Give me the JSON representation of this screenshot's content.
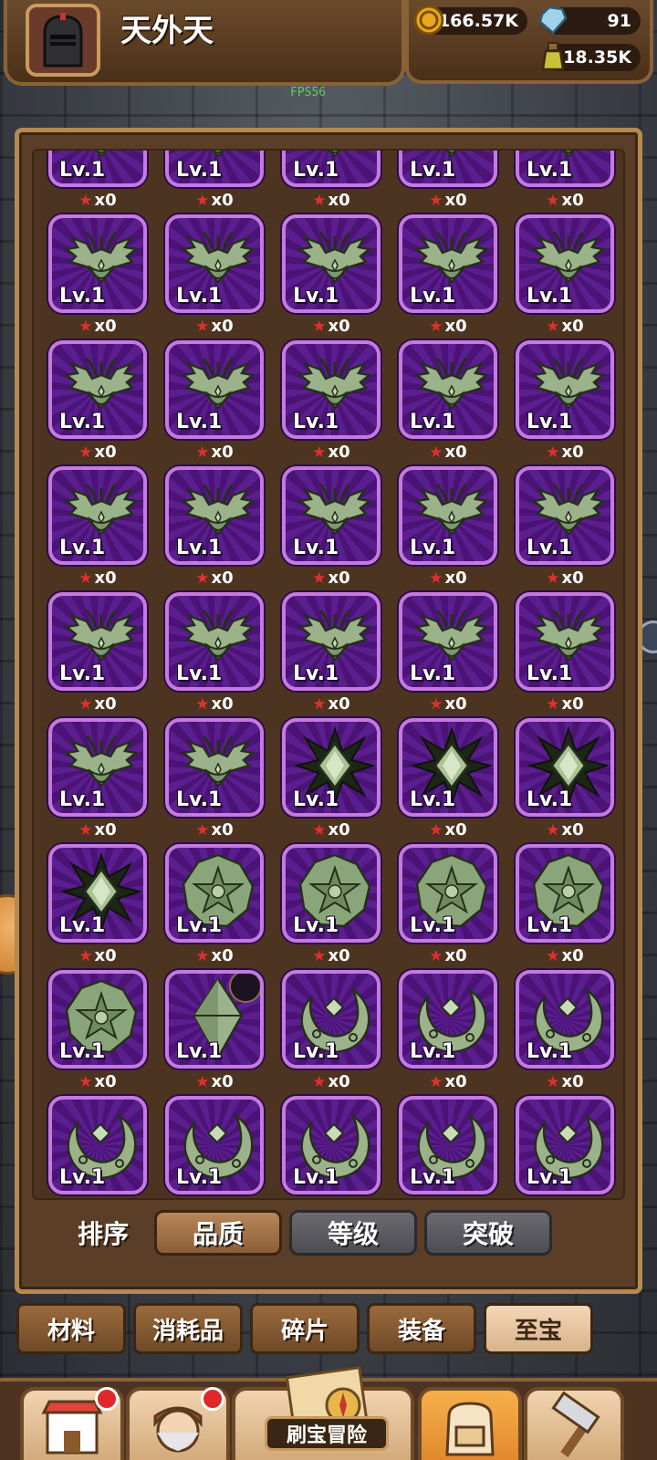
{
  "header": {
    "player_name": "天外天",
    "avatar_icon": "knight-helmet-icon",
    "gold": "166.57K",
    "gems": "91",
    "potion": "18.35K",
    "fps": "FPS56"
  },
  "items": [
    {
      "icon": "wing-emblem",
      "level": "Lv.1",
      "count": "x0"
    },
    {
      "icon": "wing-emblem",
      "level": "Lv.1",
      "count": "x0"
    },
    {
      "icon": "wing-emblem",
      "level": "Lv.1",
      "count": "x0"
    },
    {
      "icon": "wing-emblem",
      "level": "Lv.1",
      "count": "x0"
    },
    {
      "icon": "wing-emblem",
      "level": "Lv.1",
      "count": "x0"
    },
    {
      "icon": "wing-emblem",
      "level": "Lv.1",
      "count": "x0"
    },
    {
      "icon": "wing-emblem",
      "level": "Lv.1",
      "count": "x0"
    },
    {
      "icon": "wing-emblem",
      "level": "Lv.1",
      "count": "x0"
    },
    {
      "icon": "wing-emblem",
      "level": "Lv.1",
      "count": "x0"
    },
    {
      "icon": "wing-emblem",
      "level": "Lv.1",
      "count": "x0"
    },
    {
      "icon": "wing-emblem",
      "level": "Lv.1",
      "count": "x0"
    },
    {
      "icon": "wing-emblem",
      "level": "Lv.1",
      "count": "x0"
    },
    {
      "icon": "wing-emblem",
      "level": "Lv.1",
      "count": "x0"
    },
    {
      "icon": "wing-emblem",
      "level": "Lv.1",
      "count": "x0"
    },
    {
      "icon": "wing-emblem",
      "level": "Lv.1",
      "count": "x0"
    },
    {
      "icon": "wing-emblem",
      "level": "Lv.1",
      "count": "x0"
    },
    {
      "icon": "wing-emblem",
      "level": "Lv.1",
      "count": "x0"
    },
    {
      "icon": "wing-emblem",
      "level": "Lv.1",
      "count": "x0"
    },
    {
      "icon": "wing-emblem",
      "level": "Lv.1",
      "count": "x0"
    },
    {
      "icon": "wing-emblem",
      "level": "Lv.1",
      "count": "x0"
    },
    {
      "icon": "wing-emblem",
      "level": "Lv.1",
      "count": "x0"
    },
    {
      "icon": "wing-emblem",
      "level": "Lv.1",
      "count": "x0"
    },
    {
      "icon": "wing-emblem",
      "level": "Lv.1",
      "count": "x0"
    },
    {
      "icon": "wing-emblem",
      "level": "Lv.1",
      "count": "x0"
    },
    {
      "icon": "wing-emblem",
      "level": "Lv.1",
      "count": "x0"
    },
    {
      "icon": "wing-emblem",
      "level": "Lv.1",
      "count": "x0"
    },
    {
      "icon": "wing-emblem",
      "level": "Lv.1",
      "count": "x0"
    },
    {
      "icon": "spiked-star",
      "level": "Lv.1",
      "count": "x0"
    },
    {
      "icon": "spiked-star",
      "level": "Lv.1",
      "count": "x0"
    },
    {
      "icon": "spiked-star",
      "level": "Lv.1",
      "count": "x0"
    },
    {
      "icon": "spiked-star",
      "level": "Lv.1",
      "count": "x0"
    },
    {
      "icon": "star-medallion",
      "level": "Lv.1",
      "count": "x0"
    },
    {
      "icon": "star-medallion",
      "level": "Lv.1",
      "count": "x0"
    },
    {
      "icon": "star-medallion",
      "level": "Lv.1",
      "count": "x0"
    },
    {
      "icon": "star-medallion",
      "level": "Lv.1",
      "count": "x0"
    },
    {
      "icon": "star-medallion",
      "level": "Lv.1",
      "count": "x0"
    },
    {
      "icon": "crystal-diamond",
      "level": "Lv.1",
      "count": "x0",
      "badge": true
    },
    {
      "icon": "crescent-moon",
      "level": "Lv.1",
      "count": "x0"
    },
    {
      "icon": "crescent-moon",
      "level": "Lv.1",
      "count": "x0"
    },
    {
      "icon": "crescent-moon",
      "level": "Lv.1",
      "count": "x0"
    },
    {
      "icon": "crescent-moon",
      "level": "Lv.1",
      "count": "x0"
    },
    {
      "icon": "crescent-moon",
      "level": "Lv.1",
      "count": "x0"
    },
    {
      "icon": "crescent-moon",
      "level": "Lv.1",
      "count": "x0"
    },
    {
      "icon": "crescent-moon",
      "level": "Lv.1",
      "count": "x0"
    },
    {
      "icon": "crescent-moon",
      "level": "Lv.1",
      "count": "x0"
    }
  ],
  "sort": {
    "label": "排序",
    "options": [
      "品质",
      "等级",
      "突破"
    ],
    "active": "品质"
  },
  "tabs": {
    "items": [
      "材料",
      "消耗品",
      "碎片",
      "装备",
      "至宝"
    ],
    "active": "至宝"
  },
  "bottom_nav": {
    "items": [
      {
        "icon": "shop-icon",
        "notify": true
      },
      {
        "icon": "hero-portrait-icon",
        "notify": true
      },
      {
        "icon": "treasure-map-icon",
        "notify": false
      },
      {
        "icon": "backpack-icon",
        "notify": false,
        "active": true
      },
      {
        "icon": "hammer-icon",
        "notify": false
      }
    ],
    "adventure_label": "刷宝冒险"
  },
  "colors": {
    "card_border": "#c57ae0",
    "card_bg": "#5b1e8e",
    "panel": "#5a3e27",
    "active_tab": "#f4d7b6",
    "active_sort": "#b9865a"
  }
}
